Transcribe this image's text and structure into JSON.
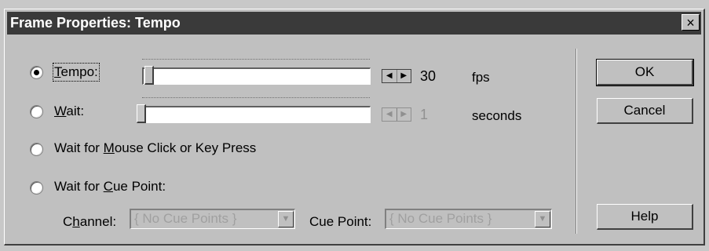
{
  "window": {
    "title": "Frame Properties: Tempo",
    "close_glyph": "×"
  },
  "options": [
    {
      "label": "Tempo:",
      "underline": "T",
      "selected": true
    },
    {
      "label": "Wait:",
      "underline": "W",
      "selected": false
    },
    {
      "label": "Wait for Mouse Click or Key Press",
      "underline": "M",
      "selected": false
    },
    {
      "label": "Wait for Cue Point:",
      "underline": "C",
      "selected": false
    }
  ],
  "tempo": {
    "value": "30",
    "unit": "fps",
    "slider_fraction": 0.0
  },
  "wait": {
    "value": "1",
    "unit": "seconds",
    "slider_fraction": 0.0
  },
  "spin_glyphs": {
    "left": "◀",
    "right": "▶"
  },
  "cue": {
    "channel_label": "Channel:",
    "channel_underline": "h",
    "channel_value": "{ No Cue Points }",
    "cuepoint_label": "Cue Point:",
    "cuepoint_underline": "u",
    "cuepoint_value": "{ No Cue Points }",
    "dropdown_glyph": "▼"
  },
  "buttons": {
    "ok": "OK",
    "cancel": "Cancel",
    "help": "Help"
  }
}
